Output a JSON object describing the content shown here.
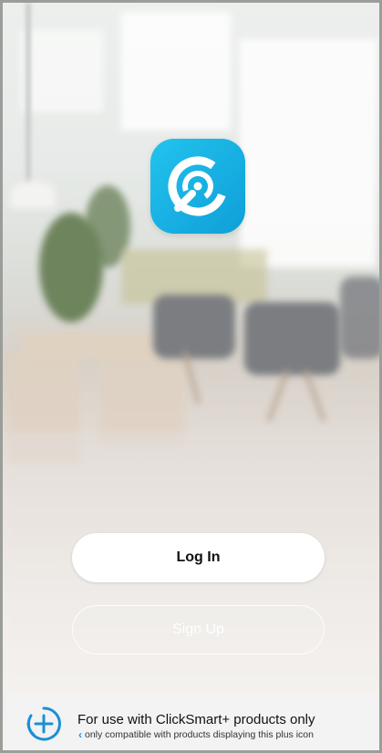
{
  "app": {
    "logo_icon": "clicksmart-logo-icon",
    "brand_color": "#1ab4e8"
  },
  "auth": {
    "login_label": "Log In",
    "signup_label": "Sign Up"
  },
  "footer": {
    "icon": "plus-circle-icon",
    "title": "For use with ClickSmart+ products only",
    "subtitle": "only compatible with products displaying this plus icon",
    "chevron_icon": "chevron-left-icon",
    "accent": "#1a90d6"
  }
}
